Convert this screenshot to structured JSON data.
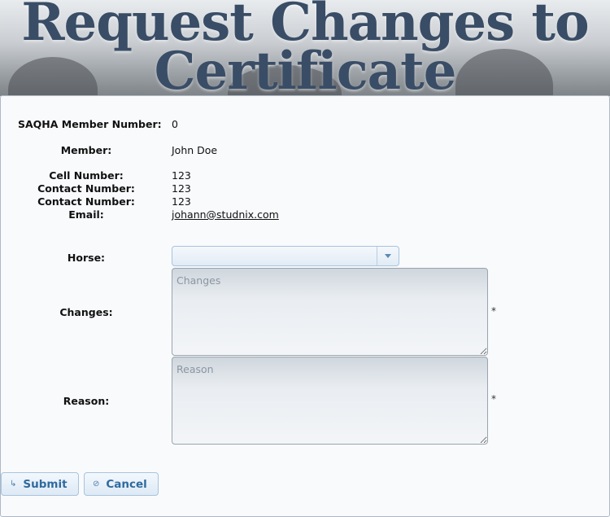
{
  "header": {
    "title": "Request Changes to Certificate"
  },
  "member_info": {
    "saqha_label": "SAQHA Member Number:",
    "saqha_value": "0",
    "member_label": "Member:",
    "member_value": "John Doe",
    "cell_label": "Cell Number:",
    "cell_value": "123",
    "contact1_label": "Contact Number:",
    "contact1_value": "123",
    "contact2_label": "Contact Number:",
    "contact2_value": "123",
    "email_label": "Email:",
    "email_value": "johann@studnix.com"
  },
  "form": {
    "horse_label": "Horse:",
    "horse_value": "",
    "changes_label": "Changes:",
    "changes_placeholder": "Changes",
    "reason_label": "Reason:",
    "reason_placeholder": "Reason",
    "required_mark": "*"
  },
  "actions": {
    "submit_label": "Submit",
    "submit_icon": "arrow-right-icon",
    "cancel_label": "Cancel",
    "cancel_icon": "cancel-circle-icon"
  },
  "colors": {
    "title": "#3a4d66",
    "button_text": "#2e6a9e",
    "panel_border": "#aeb8c6"
  }
}
